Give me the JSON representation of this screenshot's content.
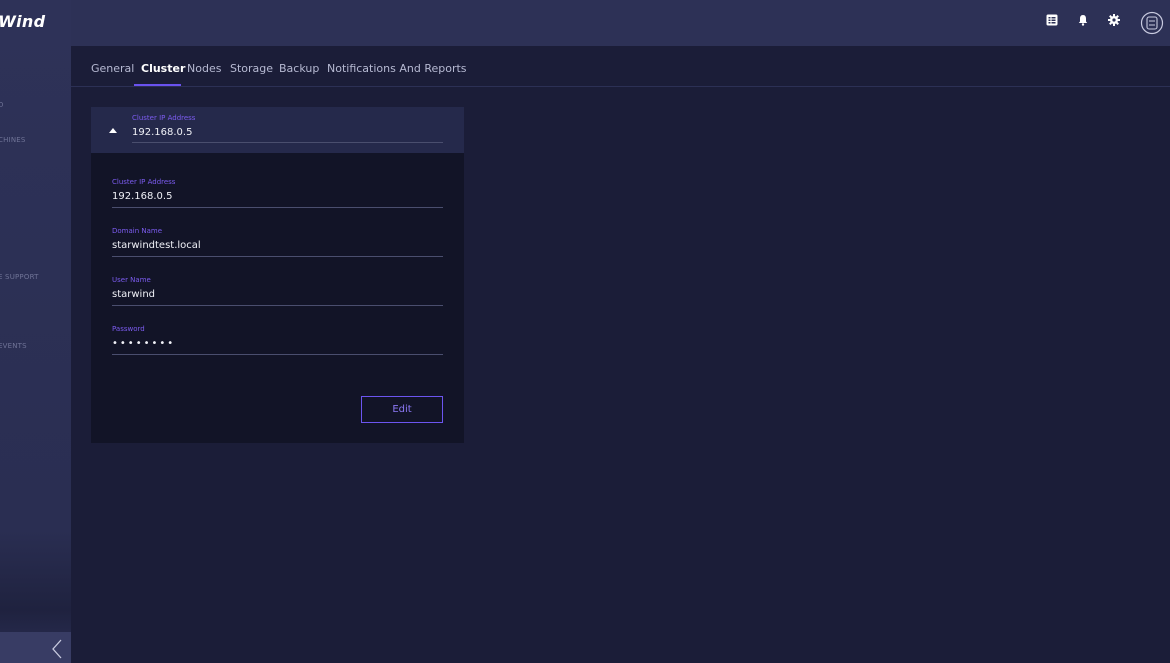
{
  "app": {
    "logo_text": "rWind"
  },
  "sidebar": {
    "items": [
      {
        "label": "D"
      },
      {
        "label": "CHINES"
      },
      {
        "label": "E SUPPORT"
      },
      {
        "label": "EVENTS"
      }
    ],
    "collapse_icon": "chevron-left-icon"
  },
  "topbar": {
    "icons": [
      "calendar-icon",
      "bell-icon",
      "gear-icon",
      "user-avatar-icon"
    ]
  },
  "tabs": [
    {
      "label": "General",
      "active": false
    },
    {
      "label": "Cluster",
      "active": true
    },
    {
      "label": "Nodes",
      "active": false
    },
    {
      "label": "Storage",
      "active": false
    },
    {
      "label": "Backup",
      "active": false
    },
    {
      "label": "Notifications And Reports",
      "active": false
    }
  ],
  "cluster_card": {
    "header": {
      "label": "Cluster IP Address",
      "value": "192.168.0.5"
    },
    "fields": [
      {
        "label": "Cluster IP Address",
        "value": "192.168.0.5"
      },
      {
        "label": "Domain Name",
        "value": "starwindtest.local"
      },
      {
        "label": "User Name",
        "value": "starwind"
      },
      {
        "label": "Password",
        "value": "••••••••"
      }
    ],
    "edit_label": "Edit"
  },
  "colors": {
    "accent": "#6a52ef",
    "background": "#1b1d38",
    "sidebar": "#2e3258",
    "card": "#121427"
  }
}
